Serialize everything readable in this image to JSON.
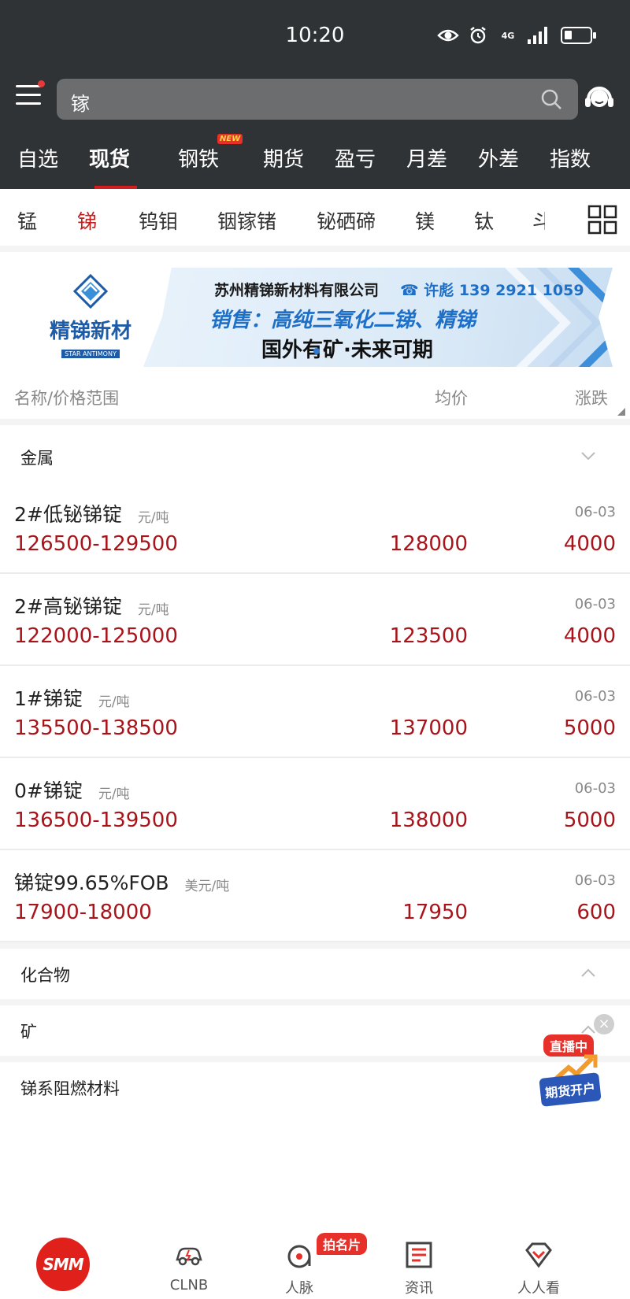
{
  "status_bar": {
    "time": "10:20",
    "network": "4G"
  },
  "search": {
    "value": "镓"
  },
  "main_tabs": [
    "自选",
    "现货",
    "钢铁",
    "期货",
    "盈亏",
    "月差",
    "外差",
    "指数"
  ],
  "main_tab_new_badge": "NEW",
  "sub_tabs": [
    "锰",
    "锑",
    "钨钼",
    "铟镓锗",
    "铋硒碲",
    "镁",
    "钛",
    "斗"
  ],
  "banner": {
    "logo_name": "精锑新材",
    "logo_sub": "STAR ANTIMONY",
    "company": "苏州精锑新材料有限公司",
    "phone": "许彪 139 2921 1059",
    "sale": "销售：高纯三氧化二锑、精锑",
    "slogan": "国外有矿·未来可期"
  },
  "list_header": {
    "name": "名称/价格范围",
    "avg": "均价",
    "change": "涨跌"
  },
  "sections": {
    "metal": "金属",
    "compound": "化合物",
    "ore": "矿",
    "flame": "锑系阻燃材料"
  },
  "rows": [
    {
      "name": "2#低铋锑锭",
      "unit": "元/吨",
      "date": "06-03",
      "range": "126500-129500",
      "avg": "128000",
      "change": "4000"
    },
    {
      "name": "2#高铋锑锭",
      "unit": "元/吨",
      "date": "06-03",
      "range": "122000-125000",
      "avg": "123500",
      "change": "4000"
    },
    {
      "name": "1#锑锭",
      "unit": "元/吨",
      "date": "06-03",
      "range": "135500-138500",
      "avg": "137000",
      "change": "5000"
    },
    {
      "name": "0#锑锭",
      "unit": "元/吨",
      "date": "06-03",
      "range": "136500-139500",
      "avg": "138000",
      "change": "5000"
    },
    {
      "name": "锑锭99.65%FOB",
      "unit": "美元/吨",
      "date": "06-03",
      "range": "17900-18000",
      "avg": "17950",
      "change": "600"
    }
  ],
  "live_float": {
    "top": "直播中",
    "bottom": "期货开户"
  },
  "bottom_nav": {
    "logo": "SMM",
    "items": [
      "CLNB",
      "人脉",
      "资讯",
      "人人看"
    ],
    "card_badge": "拍名片"
  },
  "colors": {
    "header_bg": "#2f3336",
    "accent_red": "#c0201e",
    "price_red": "#a8141a",
    "brand_blue": "#1e6fc8"
  }
}
